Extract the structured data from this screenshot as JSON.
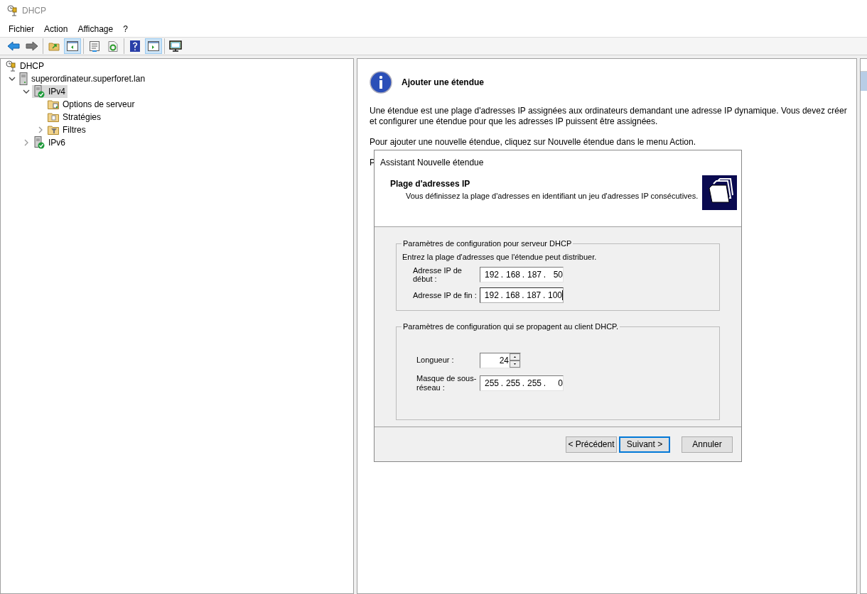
{
  "window": {
    "title": "DHCP"
  },
  "menu": [
    "Fichier",
    "Action",
    "Affichage",
    "?"
  ],
  "toolbar": [
    [
      {
        "kind": "back",
        "pressed": false
      },
      {
        "kind": "forward",
        "pressed": false
      }
    ],
    [
      {
        "kind": "up",
        "pressed": false
      },
      {
        "kind": "tree",
        "pressed": true
      }
    ],
    [
      {
        "kind": "properties",
        "pressed": false
      },
      {
        "kind": "refresh",
        "pressed": false
      }
    ],
    [
      {
        "kind": "help",
        "pressed": false
      },
      {
        "kind": "actions",
        "pressed": true
      }
    ],
    [
      {
        "kind": "monitor",
        "pressed": false
      }
    ]
  ],
  "tree": [
    {
      "label": "DHCP",
      "kind": "dhcp",
      "selected": false,
      "children": [
        {
          "label": "superordinateur.superforet.lan",
          "kind": "server",
          "selected": false,
          "expanded": true,
          "children": [
            {
              "label": "IPv4",
              "kind": "ip",
              "selected": true,
              "expanded": true,
              "children": [
                {
                  "label": "Options de serveur",
                  "kind": "options",
                  "selected": false
                },
                {
                  "label": "Stratégies",
                  "kind": "folder",
                  "selected": false
                },
                {
                  "label": "Filtres",
                  "kind": "filter",
                  "selected": false,
                  "expanded": false
                }
              ]
            },
            {
              "label": "IPv6",
              "kind": "ip",
              "selected": false,
              "expanded": false
            }
          ]
        }
      ]
    }
  ],
  "results": {
    "heading": "Ajouter une étendue",
    "paragraphs": [
      "Une étendue est une plage d'adresses IP assignées aux ordinateurs demandant une adresse IP dynamique. Vous devez créer et configurer une étendue pour que les adresses IP puissent être assignées.",
      "Pour ajouter une nouvelle étendue, cliquez sur Nouvelle étendue dans le menu Action.",
      "P"
    ]
  },
  "wizard": {
    "octet_separator": ".",
    "title": "Assistant Nouvelle étendue",
    "heading": "Plage d'adresses IP",
    "subtitle": "Vous définissez la plage d'adresses en identifiant un jeu d'adresses IP consécutives.",
    "server_group": {
      "legend": "Paramètres de configuration pour serveur DHCP",
      "intro": "Entrez la plage d'adresses que l'étendue peut distribuer.",
      "fields": [
        {
          "label": "Adresse IP de début :",
          "octets": [
            "192",
            "168",
            "187",
            "50"
          ],
          "focused": false
        },
        {
          "label": "Adresse IP de fin :",
          "octets": [
            "192",
            "168",
            "187",
            "100"
          ],
          "focused": true
        }
      ]
    },
    "client_group": {
      "legend": "Paramètres de configuration qui se propagent au client DHCP.",
      "length": {
        "label": "Longueur :",
        "value": "24"
      },
      "mask": {
        "label": "Masque de sous-réseau :",
        "octets": [
          "255",
          "255",
          "255",
          "0"
        ]
      }
    },
    "buttons": [
      {
        "label": "< Précédent",
        "default": false
      },
      {
        "label": "Suivant >",
        "default": true
      },
      {
        "label": "Annuler",
        "default": false
      }
    ]
  }
}
